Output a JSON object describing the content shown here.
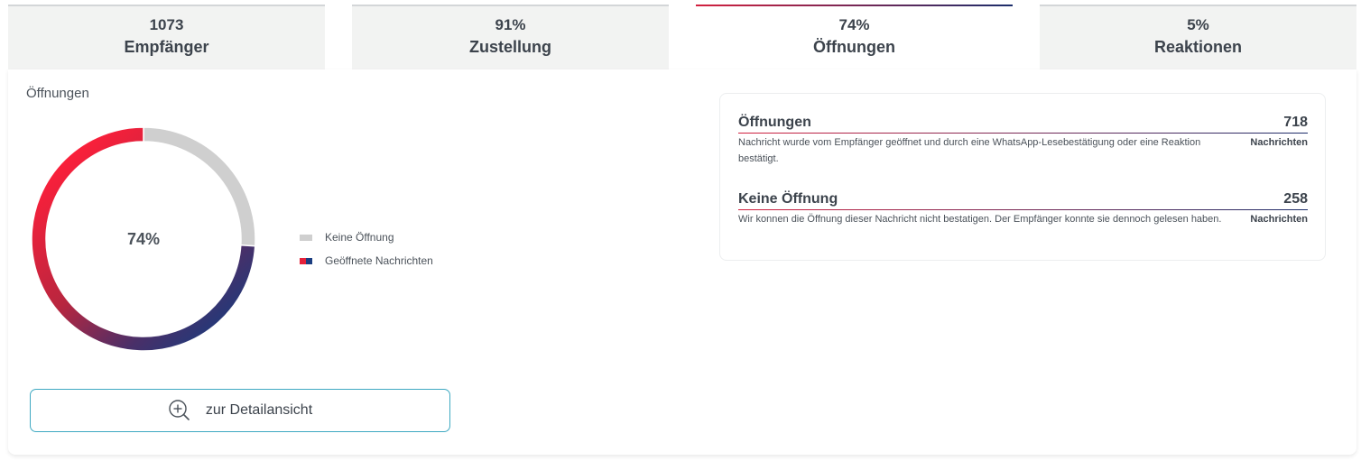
{
  "tabs": [
    {
      "value": "1073",
      "label": "Empfänger",
      "active": false
    },
    {
      "value": "91%",
      "label": "Zustellung",
      "active": false
    },
    {
      "value": "74%",
      "label": "Öffnungen",
      "active": true
    },
    {
      "value": "5%",
      "label": "Reaktionen",
      "active": false
    }
  ],
  "section": {
    "title": "Öffnungen"
  },
  "chart_data": {
    "type": "pie",
    "title": "",
    "center_label": "74%",
    "slices": [
      {
        "label": "Keine Öffnung",
        "value": 26,
        "color": "#cfcfcf"
      },
      {
        "label": "Geöffnete Nachrichten",
        "value": 74,
        "gradient": [
          "#e5213a",
          "#1b3d80"
        ]
      }
    ],
    "legend_position": "right"
  },
  "legend": {
    "items": [
      "Keine Öffnung",
      "Geöffnete Nachrichten"
    ]
  },
  "detail_button": {
    "label": "zur Detailansicht",
    "icon": "zoom-in-icon"
  },
  "info": {
    "rows": [
      {
        "title": "Öffnungen",
        "count": "718",
        "unit": "Nachrichten",
        "description": "Nachricht wurde vom Empfänger geöffnet und durch eine WhatsApp-Lesebestätigung oder eine Reaktion bestätigt."
      },
      {
        "title": "Keine Öffnung",
        "count": "258",
        "unit": "Nachrichten",
        "description": "Wir konnen die Öffnung dieser Nachricht nicht bestatigen. Der Empfänger konnte sie dennoch gelesen haben."
      }
    ]
  },
  "colors": {
    "accent_red": "#e5213a",
    "accent_navy": "#1b3d80",
    "button_border": "#3fa9c2",
    "tab_bg": "#f2f3f2"
  }
}
